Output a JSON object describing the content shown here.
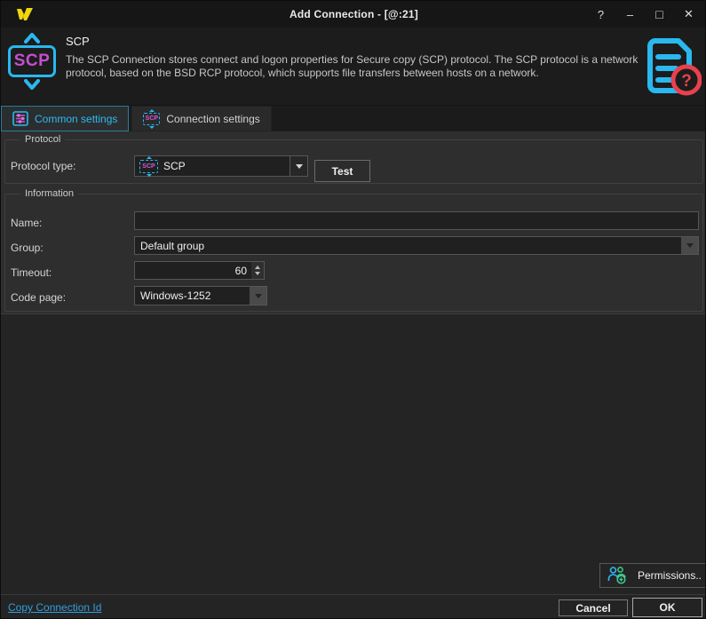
{
  "window": {
    "title": "Add Connection - [@:21]",
    "controls": {
      "help": "?",
      "minimize": "–",
      "maximize": "□",
      "close": "✕"
    }
  },
  "header": {
    "title": "SCP",
    "badge_text": "SCP",
    "description": "The SCP Connection stores connect and logon properties for Secure copy (SCP) protocol. The SCP protocol is a network protocol, based on the BSD RCP protocol, which supports file transfers between hosts on a network."
  },
  "tabs": {
    "common": {
      "label": "Common settings",
      "active": true
    },
    "connection": {
      "label": "Connection settings",
      "active": false
    }
  },
  "protocol": {
    "legend": "Protocol",
    "type_label": "Protocol type:",
    "type_value": "SCP",
    "test_button": "Test"
  },
  "information": {
    "legend": "Information",
    "name_label": "Name:",
    "name_value": "",
    "group_label": "Group:",
    "group_value": "Default group",
    "timeout_label": "Timeout:",
    "timeout_value": "60",
    "codepage_label": "Code page:",
    "codepage_value": "Windows-1252"
  },
  "footer": {
    "permissions_button": "Permissions..",
    "copy_link": "Copy Connection Id",
    "cancel_button": "Cancel",
    "ok_button": "OK"
  },
  "icons": {
    "scp_mini_text": "SCP"
  },
  "colors": {
    "accent_cyan": "#29b8f0",
    "accent_magenta": "#c44fd0",
    "accent_red": "#e8414d",
    "logo_yellow": "#f2d50a",
    "link_blue": "#2f9fdc",
    "panel_bg": "#2e2e2e",
    "dialog_bg": "#242424",
    "titlebar_bg": "#161616"
  }
}
